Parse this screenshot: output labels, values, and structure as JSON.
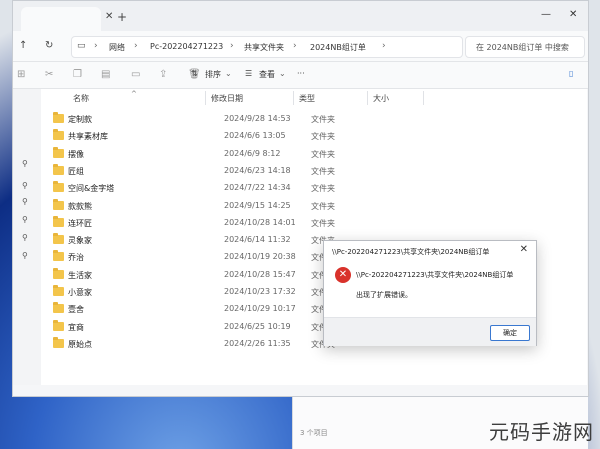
{
  "explorer": {
    "tab": {
      "close": "✕",
      "new": "+"
    },
    "window_controls": {
      "minimize": "—",
      "close": "✕"
    },
    "nav": {
      "back": "↑",
      "refresh": "↻"
    },
    "breadcrumb": [
      "网络",
      "Pc-202204271223",
      "共享文件夹",
      "2024NB组订单"
    ],
    "breadcrumb_sep": "›",
    "search_placeholder": "在 2024NB组订单 中搜索",
    "command_bar": {
      "sort_label": "排序",
      "view_label": "查看",
      "more": "···"
    },
    "columns": {
      "name": "名称",
      "date": "修改日期",
      "type": "类型",
      "size": "大小"
    },
    "files": [
      {
        "name": "定制款",
        "date": "2024/9/28 14:53",
        "type": "文件夹"
      },
      {
        "name": "共享素材库",
        "date": "2024/6/6 13:05",
        "type": "文件夹"
      },
      {
        "name": "摆像",
        "date": "2024/6/9 8:12",
        "type": "文件夹"
      },
      {
        "name": "匠组",
        "date": "2024/6/23 14:18",
        "type": "文件夹"
      },
      {
        "name": "空间&金字塔",
        "date": "2024/7/22 14:34",
        "type": "文件夹"
      },
      {
        "name": "款款熊",
        "date": "2024/9/15 14:25",
        "type": "文件夹"
      },
      {
        "name": "连环匠",
        "date": "2024/10/28 14:01",
        "type": "文件夹"
      },
      {
        "name": "灵象家",
        "date": "2024/6/14 11:32",
        "type": "文件夹"
      },
      {
        "name": "乔治",
        "date": "2024/10/19 20:38",
        "type": "文件夹"
      },
      {
        "name": "生活家",
        "date": "2024/10/28 15:47",
        "type": "文件夹"
      },
      {
        "name": "小意家",
        "date": "2024/10/23 17:32",
        "type": "文件夹"
      },
      {
        "name": "壹舍",
        "date": "2024/10/29 10:17",
        "type": "文件夹"
      },
      {
        "name": "宜商",
        "date": "2024/6/25 10:19",
        "type": "文件夹"
      },
      {
        "name": "原始点",
        "date": "2024/2/26 11:35",
        "type": "文件夹"
      }
    ],
    "status": "3 个项目"
  },
  "dialog": {
    "title": "\\\\Pc-202204271223\\共享文件夹\\2024NB组订单",
    "close": "✕",
    "icon": "✕",
    "path": "\\\\Pc-202204271223\\共享文件夹\\2024NB组订单",
    "message": "出现了扩展错误。",
    "ok_label": "确定"
  },
  "watermark": "元码手游网",
  "colors": {
    "folder": "#f3c54b",
    "error": "#d9322b",
    "accent": "#3a78d0"
  }
}
